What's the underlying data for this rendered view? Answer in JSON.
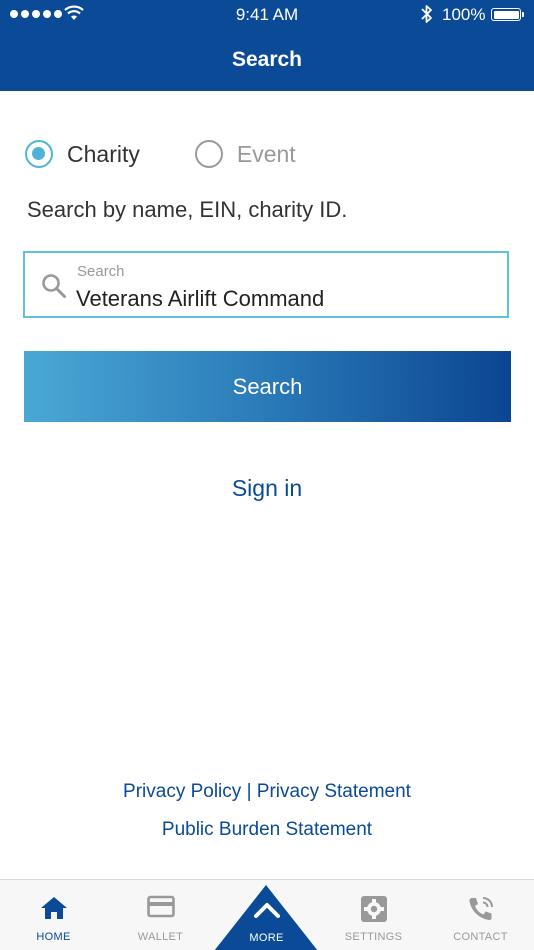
{
  "status_bar": {
    "time": "9:41 AM",
    "battery": "100%"
  },
  "nav": {
    "title": "Search"
  },
  "search_type": {
    "options": [
      {
        "label": "Charity",
        "selected": true
      },
      {
        "label": "Event",
        "selected": false
      }
    ]
  },
  "hint": "Search by name, EIN, charity ID.",
  "search": {
    "label": "Search",
    "value": "Veterans Airlift Command",
    "button_label": "Search"
  },
  "signin_label": "Sign in",
  "footer": {
    "privacy_policy": "Privacy Policy",
    "separator": "|",
    "privacy_statement": "Privacy Statement",
    "public_burden": "Public Burden Statement"
  },
  "tabs": [
    {
      "label": "HOME",
      "icon": "home-icon",
      "active": true
    },
    {
      "label": "WALLET",
      "icon": "wallet-icon",
      "active": false
    },
    {
      "label": "MORE",
      "icon": "chevron-up-icon",
      "active": false
    },
    {
      "label": "SETTINGS",
      "icon": "gear-icon",
      "active": false
    },
    {
      "label": "CONTACT",
      "icon": "phone-icon",
      "active": false
    }
  ],
  "colors": {
    "brand_blue": "#0a4a96",
    "accent_cyan": "#4fb3d9"
  }
}
